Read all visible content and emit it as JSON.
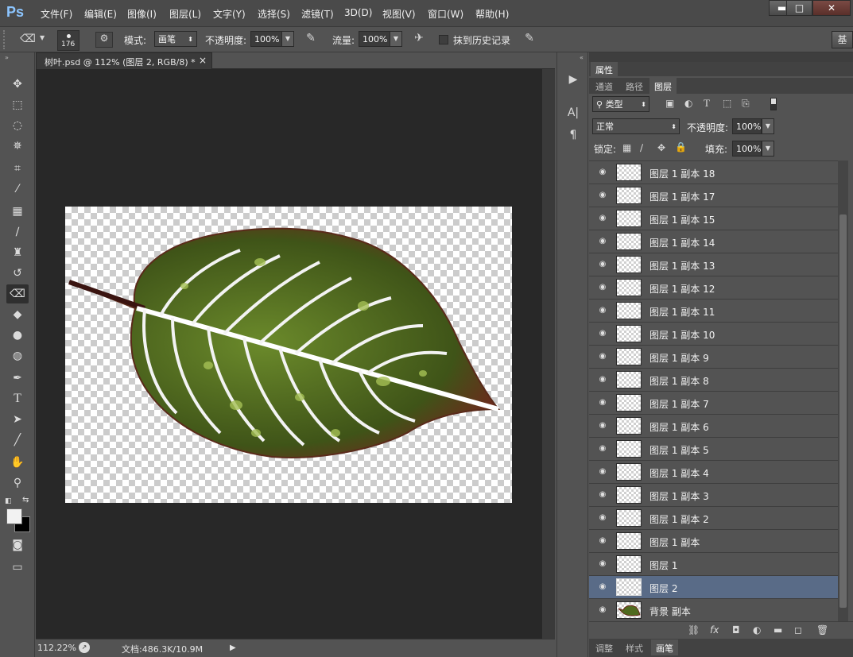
{
  "app": {
    "logo": "Ps"
  },
  "menu": [
    "文件(F)",
    "编辑(E)",
    "图像(I)",
    "图层(L)",
    "文字(Y)",
    "选择(S)",
    "滤镜(T)",
    "3D(D)",
    "视图(V)",
    "窗口(W)",
    "帮助(H)"
  ],
  "window": {
    "minimize": "▬",
    "maximize": "□",
    "close": "✕"
  },
  "options": {
    "brush_size": "176",
    "mode_label": "模式:",
    "mode_value": "画笔",
    "opacity_label": "不透明度:",
    "opacity_value": "100%",
    "flow_label": "流量:",
    "flow_value": "100%",
    "erase_history_label": "抹到历史记录",
    "workspace_label": "基"
  },
  "document": {
    "tab_title": "树叶.psd @ 112% (图层 2, RGB/8) *",
    "close": "×"
  },
  "status": {
    "zoom": "112.22%",
    "doc_info": "文档:486.3K/10.9M"
  },
  "panel": {
    "properties_tab": "属性",
    "tabs": [
      "通道",
      "路径",
      "图层"
    ],
    "filter_label": "类型",
    "blend_mode": "正常",
    "opacity_label": "不透明度:",
    "opacity_value": "100%",
    "lock_label": "锁定:",
    "fill_label": "填充:",
    "fill_value": "100%",
    "bottom_tabs": [
      "调整",
      "样式",
      "画笔"
    ]
  },
  "layers": [
    {
      "name": "图层 1 副本 18"
    },
    {
      "name": "图层 1 副本 17"
    },
    {
      "name": "图层 1 副本 15"
    },
    {
      "name": "图层 1 副本 14"
    },
    {
      "name": "图层 1 副本 13"
    },
    {
      "name": "图层 1 副本 12"
    },
    {
      "name": "图层 1 副本 11"
    },
    {
      "name": "图层 1 副本 10"
    },
    {
      "name": "图层 1 副本 9"
    },
    {
      "name": "图层 1 副本 8"
    },
    {
      "name": "图层 1 副本 7"
    },
    {
      "name": "图层 1 副本 6"
    },
    {
      "name": "图层 1 副本 5"
    },
    {
      "name": "图层 1 副本 4"
    },
    {
      "name": "图层 1 副本 3"
    },
    {
      "name": "图层 1 副本 2"
    },
    {
      "name": "图层 1 副本"
    },
    {
      "name": "图层 1"
    },
    {
      "name": "图层 2",
      "selected": true
    },
    {
      "name": "背景 副本",
      "leaf_thumb": true
    }
  ],
  "colors": {
    "accent": "#8cc5ff",
    "selection": "#596b87",
    "leaf_dark": "#3f5418",
    "leaf_light": "#6b8a2b",
    "leaf_edge": "#6b2b1c"
  }
}
